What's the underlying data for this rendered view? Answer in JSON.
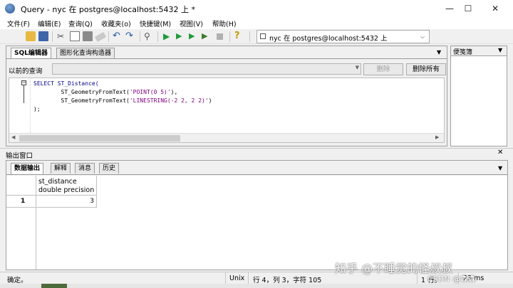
{
  "window": {
    "title": "Query - nyc 在  postgres@localhost:5432 上 *",
    "minimize": "—",
    "maximize": "☐",
    "close": "✕"
  },
  "menu": [
    "文件(F)",
    "编辑(E)",
    "查询(Q)",
    "收藏夹(o)",
    "快捷键(M)",
    "视图(V)",
    "帮助(H)"
  ],
  "toolbar": {
    "icons": [
      "open-folder-icon",
      "save-icon",
      "cut-icon",
      "copy-icon",
      "paste-icon",
      "eraser-icon",
      "undo-icon",
      "redo-icon",
      "find-icon",
      "execute-icon",
      "explain-icon",
      "execute-to-file-icon",
      "stop-icon",
      "hint-icon"
    ],
    "connection": "nyc 在  postgres@localhost:5432 上"
  },
  "editor": {
    "tabs": [
      "SQL编辑器",
      "图形化查询构造器"
    ],
    "previous_queries_label": "以前的查询",
    "delete_label": "删除",
    "delete_all_label": "删除所有",
    "code_lines": [
      "SELECT ST_Distance(",
      "        ST_GeometryFromText('POINT(0 5)'),",
      "        ST_GeometryFromText('LINESTRING(-2 2, 2 2)')",
      ");"
    ]
  },
  "notepad": {
    "title": "便笺簿"
  },
  "output": {
    "title": "输出窗口",
    "tabs": [
      "数据输出",
      "解释",
      "消息",
      "历史"
    ],
    "columns": [
      {
        "name": "st_distance",
        "type": "double precision"
      }
    ],
    "rows": [
      {
        "num": "1",
        "values": [
          "3"
        ]
      }
    ]
  },
  "status": {
    "message": "确定。",
    "encoding": "Unix",
    "position": "行 4，列 3，字符 105",
    "rows": "1 行。",
    "time": "23 ms"
  },
  "watermark": "知乎 @不睡觉的怪叔叔",
  "watermark2": "CSDN @森森"
}
